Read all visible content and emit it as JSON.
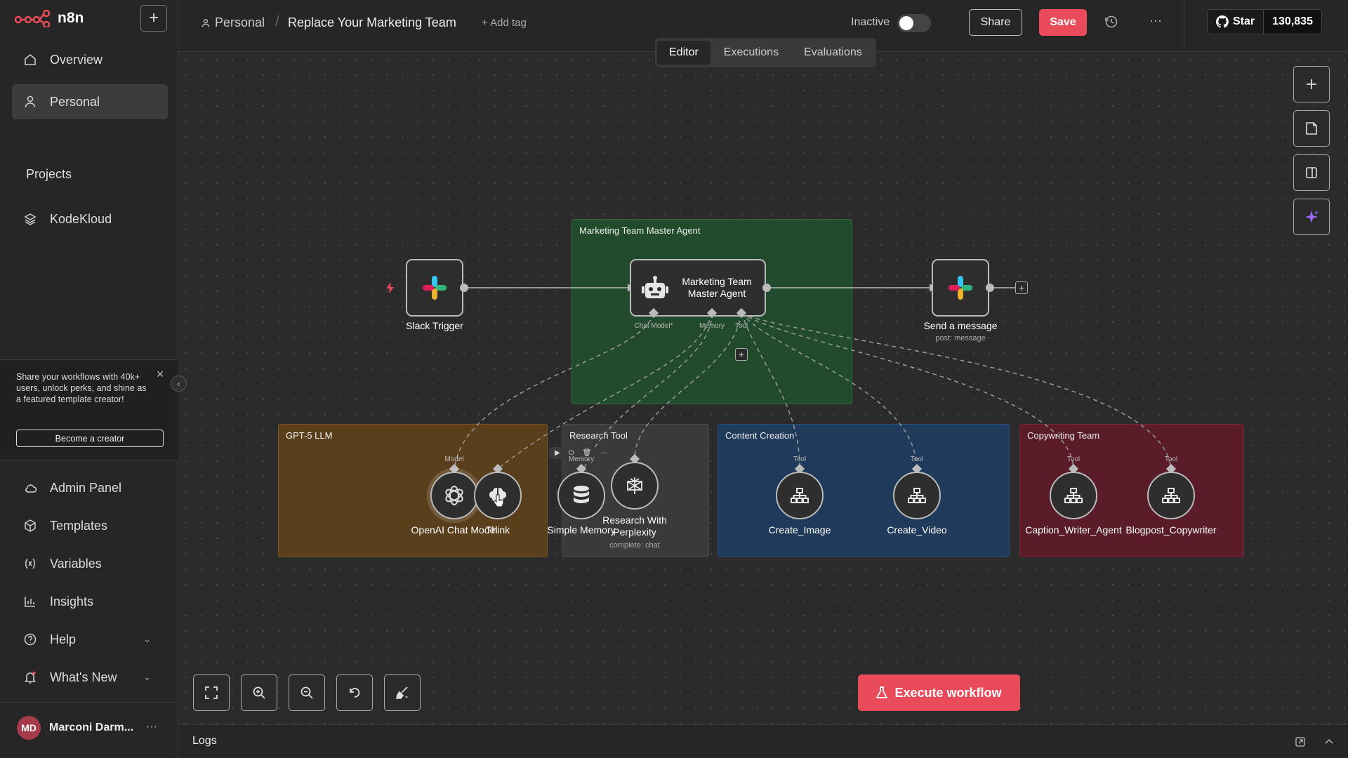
{
  "app": {
    "name": "n8n"
  },
  "sidebar": {
    "items": [
      {
        "label": "Overview"
      },
      {
        "label": "Personal"
      }
    ],
    "projects_heading": "Projects",
    "projects": [
      {
        "label": "KodeKloud"
      }
    ],
    "promo": {
      "text": "Share your workflows with 40k+ users, unlock perks, and shine as a featured template creator!",
      "button": "Become a creator"
    },
    "bottom_items": [
      {
        "label": "Admin Panel"
      },
      {
        "label": "Templates"
      },
      {
        "label": "Variables"
      },
      {
        "label": "Insights"
      },
      {
        "label": "Help"
      },
      {
        "label": "What's New"
      }
    ],
    "user": {
      "initials": "MD",
      "name": "Marconi Darm..."
    }
  },
  "header": {
    "breadcrumb": "Personal",
    "title": "Replace Your Marketing Team",
    "add_tag": "+ Add tag",
    "status": "Inactive",
    "share": "Share",
    "save": "Save",
    "star_label": "Star",
    "star_count": "130,835"
  },
  "tabs": [
    {
      "label": "Editor"
    },
    {
      "label": "Executions"
    },
    {
      "label": "Evaluations"
    }
  ],
  "workflow": {
    "groups": {
      "master": "Marketing Team Master Agent",
      "llm": "GPT-5 LLM",
      "research": "Research Tool",
      "content": "Content Creation",
      "copy": "Copywriting Team"
    },
    "nodes": {
      "slack_trigger": "Slack Trigger",
      "agent": "Marketing Team Master Agent",
      "send_message": "Send a message",
      "send_message_sub": "post: message",
      "openai": "OpenAI Chat Model",
      "think": "Think",
      "memory": "Simple Memory",
      "research": "Research With Perplexity",
      "research_sub": "complete: chat",
      "create_image": "Create_Image",
      "create_video": "Create_Video",
      "caption": "Caption_Writer_Agent",
      "blogpost": "Blogpost_Copywriter"
    },
    "ports": {
      "chat_model": "Chat Model*",
      "memory": "Memory",
      "tool": "Tool",
      "model": "Model"
    }
  },
  "execute": "Execute workflow",
  "logs": "Logs",
  "colors": {
    "accent": "#ea4b5a",
    "master_group": "#214b2c",
    "llm_group": "#5a3f1c",
    "research_group": "#3a3a3a",
    "content_group": "#1f3a5a",
    "copy_group": "#5a1c28"
  }
}
